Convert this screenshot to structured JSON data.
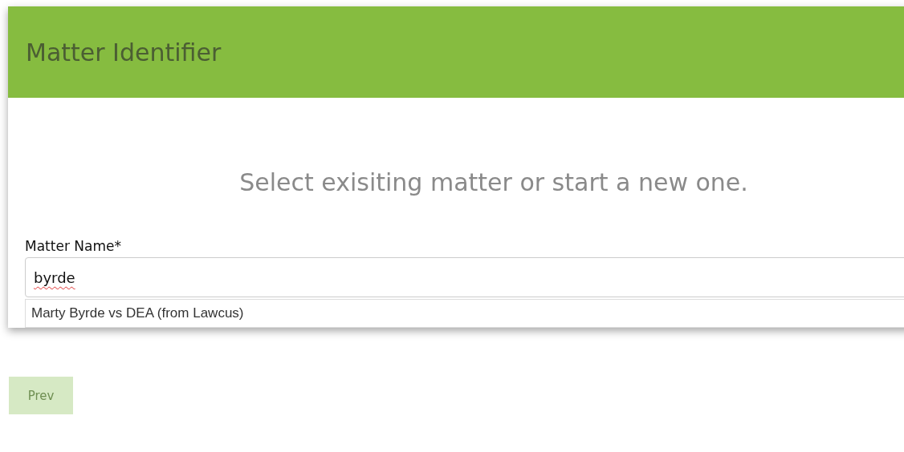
{
  "dialog": {
    "title": "Matter Identifier",
    "prompt": "Select exisiting matter or start a new one.",
    "field": {
      "label": "Matter Name*",
      "value": "byrde",
      "spellcheck_error": true
    },
    "suggestions": [
      {
        "label": "Marty Byrde vs DEA (from Lawcus)"
      }
    ]
  },
  "buttons": [
    {
      "label": "Prev",
      "disabled": true
    }
  ]
}
